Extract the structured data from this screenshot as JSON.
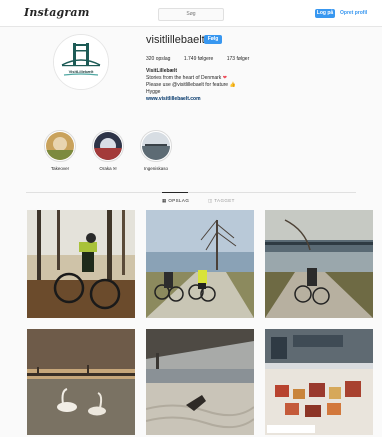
{
  "nav": {
    "logo": "Instagram",
    "search_placeholder": "Søg",
    "login_label": "Log på",
    "signup_label": "Opret profil"
  },
  "profile": {
    "username": "visitlillebaelt",
    "follow_label": "Følg",
    "avatar_text": "VisitLillebælt",
    "stats": {
      "posts": "320 opslag",
      "followers": "1.749 følgere",
      "following": "173 følger"
    },
    "bio": {
      "name": "VisitLillebælt",
      "line1": "Stories from the heart of Denmark",
      "line2": "Please use @visitlillebaelt for feature",
      "line3": "Hygge",
      "link": "www.visitlillebaelt.com"
    }
  },
  "highlights": [
    {
      "label": "Takeover"
    },
    {
      "label": "Oraka"
    },
    {
      "label": "Ingeniskaso"
    }
  ],
  "tabs": {
    "posts": "OPSLAG",
    "tagged": "TAGGET"
  },
  "colors": {
    "accent": "#3897f0",
    "heart": "#ed4956",
    "brand_teal": "#1d5b56"
  }
}
